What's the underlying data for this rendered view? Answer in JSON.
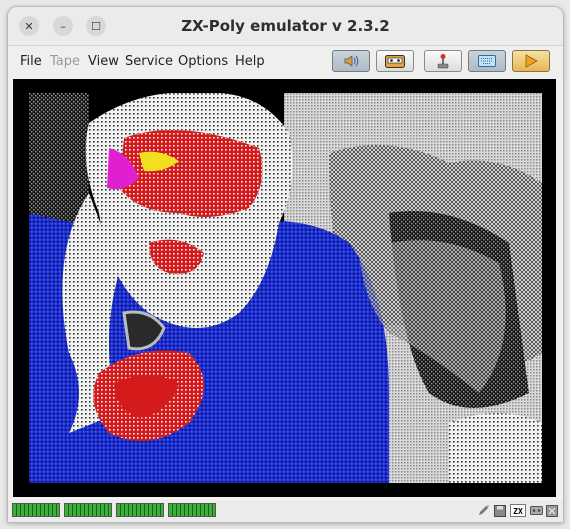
{
  "window": {
    "title": "ZX-Poly emulator v 2.3.2"
  },
  "menu": [
    {
      "label": "File",
      "enabled": true
    },
    {
      "label": "Tape",
      "enabled": false
    },
    {
      "label": "View",
      "enabled": true
    },
    {
      "label": "Service",
      "enabled": true
    },
    {
      "label": "Options",
      "enabled": true
    },
    {
      "label": "Help",
      "enabled": true
    }
  ],
  "toolbar": [
    {
      "icon": "speaker-icon",
      "pressed": true
    },
    {
      "icon": "cassette-tape-icon",
      "pressed": false
    },
    {
      "icon": "joystick-icon",
      "pressed": false
    },
    {
      "icon": "keyboard-icon",
      "pressed": true
    },
    {
      "icon": "play-triangle-icon",
      "pressed": false
    }
  ],
  "screen": {
    "content": "ZX Spectrum display showing a dithered multicolour portrait of an old bearded man holding a pipe"
  },
  "status": {
    "indicators": [
      "cpu-0-led",
      "cpu-1-led",
      "cpu-2-led",
      "cpu-3-led"
    ],
    "zx_logo": "ZX",
    "colors": {
      "led_on": "#3bb03b",
      "led_off": "#1d5f1d"
    }
  }
}
